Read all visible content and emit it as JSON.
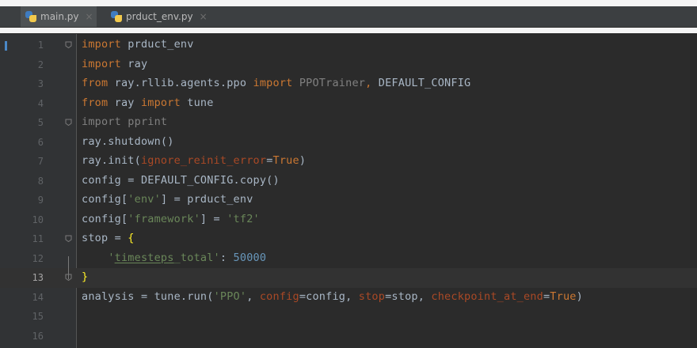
{
  "tabs": [
    {
      "label": "main.py",
      "active": true
    },
    {
      "label": "prduct_env.py",
      "active": false
    }
  ],
  "current_line": 13,
  "lines": [
    {
      "n": "1",
      "tokens": [
        [
          "kw",
          "import"
        ],
        [
          "ident",
          " prduct_env"
        ]
      ]
    },
    {
      "n": "2",
      "tokens": [
        [
          "kw",
          "import"
        ],
        [
          "ident",
          " ray"
        ]
      ]
    },
    {
      "n": "3",
      "tokens": [
        [
          "kw",
          "from"
        ],
        [
          "ident",
          " ray.rllib.agents.ppo "
        ],
        [
          "kw",
          "import "
        ],
        [
          "dim",
          "PPOTrainer"
        ],
        [
          "kw",
          ", "
        ],
        [
          "ident",
          "DEFAULT_CONFIG"
        ]
      ]
    },
    {
      "n": "4",
      "tokens": [
        [
          "kw",
          "from"
        ],
        [
          "ident",
          " ray "
        ],
        [
          "kw",
          "import"
        ],
        [
          "ident",
          " tune"
        ]
      ]
    },
    {
      "n": "5",
      "tokens": [
        [
          "dim",
          "import pprint"
        ]
      ]
    },
    {
      "n": "6",
      "tokens": [
        [
          "ident",
          "ray.shutdown()"
        ]
      ]
    },
    {
      "n": "7",
      "tokens": [
        [
          "ident",
          "ray.init("
        ],
        [
          "param",
          "ignore_reinit_error"
        ],
        [
          "ident",
          "="
        ],
        [
          "kw",
          "True"
        ],
        [
          "ident",
          ")"
        ]
      ]
    },
    {
      "n": "8",
      "tokens": [
        [
          "ident",
          "config = DEFAULT_CONFIG.copy()"
        ]
      ]
    },
    {
      "n": "9",
      "tokens": [
        [
          "ident",
          "config["
        ],
        [
          "str",
          "'env'"
        ],
        [
          "ident",
          "] = prduct_env"
        ]
      ]
    },
    {
      "n": "10",
      "tokens": [
        [
          "ident",
          "config["
        ],
        [
          "str",
          "'framework'"
        ],
        [
          "ident",
          "] = "
        ],
        [
          "str",
          "'tf2'"
        ]
      ]
    },
    {
      "n": "11",
      "tokens": [
        [
          "ident",
          "stop = "
        ],
        [
          "brace",
          "{"
        ]
      ]
    },
    {
      "n": "12",
      "tokens": [
        [
          "ident",
          "    "
        ],
        [
          "str",
          "'"
        ],
        [
          "str-u",
          "timesteps"
        ],
        [
          "str",
          "_total'"
        ],
        [
          "ident",
          ": "
        ],
        [
          "num",
          "50000"
        ]
      ]
    },
    {
      "n": "13",
      "tokens": [
        [
          "brace",
          "}"
        ]
      ]
    },
    {
      "n": "14",
      "tokens": [
        [
          "ident",
          "analysis = tune.run("
        ],
        [
          "str",
          "'PPO'"
        ],
        [
          "ident",
          ", "
        ],
        [
          "param",
          "config"
        ],
        [
          "ident",
          "=config, "
        ],
        [
          "param",
          "stop"
        ],
        [
          "ident",
          "=stop, "
        ],
        [
          "param",
          "checkpoint_at_end"
        ],
        [
          "ident",
          "="
        ],
        [
          "kw",
          "True"
        ],
        [
          "ident",
          ")"
        ]
      ]
    },
    {
      "n": "15",
      "tokens": []
    },
    {
      "n": "16",
      "tokens": []
    }
  ],
  "folds": [
    1,
    5,
    11,
    13
  ],
  "colors": {
    "background": "#2b2b2b",
    "keyword": "#cc7832",
    "string": "#6a8759",
    "number": "#6897bb",
    "parameter": "#aa4926",
    "identifier": "#a9b7c6",
    "brace": "#ffef28"
  }
}
